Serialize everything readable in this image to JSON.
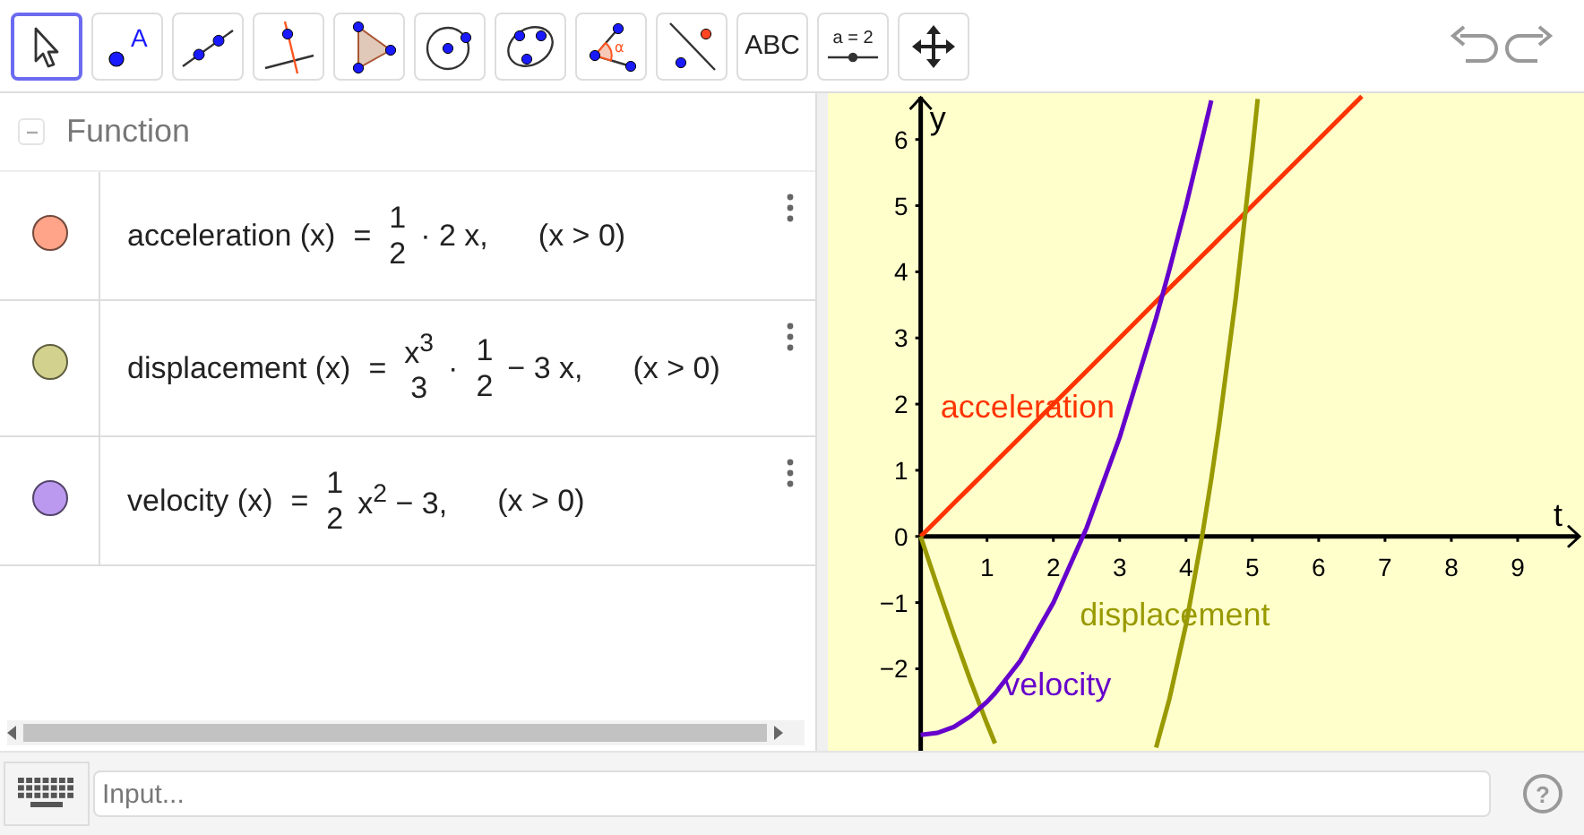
{
  "toolbar": {
    "tools": [
      {
        "kind": "move",
        "selected": true
      },
      {
        "kind": "point",
        "label": "A",
        "selected": false
      },
      {
        "kind": "line",
        "selected": false
      },
      {
        "kind": "perpendicular",
        "selected": false
      },
      {
        "kind": "polygon",
        "selected": false
      },
      {
        "kind": "circle",
        "selected": false
      },
      {
        "kind": "conic",
        "selected": false
      },
      {
        "kind": "angle",
        "label": "α",
        "selected": false
      },
      {
        "kind": "reflect",
        "selected": false
      },
      {
        "kind": "text",
        "label": "ABC",
        "selected": false
      },
      {
        "kind": "slider",
        "label": "a = 2",
        "selected": false
      },
      {
        "kind": "pan",
        "selected": false
      }
    ]
  },
  "algebra": {
    "group": {
      "title": "Function",
      "expanded": true
    },
    "functions": [
      {
        "name": "acceleration (x)",
        "color": "#ffa488",
        "parts": [
          {
            "kind": "text",
            "text": "="
          },
          {
            "kind": "frac",
            "num": "1",
            "den": "2"
          },
          {
            "kind": "text",
            "text": "· 2 x,"
          }
        ],
        "condition": "(x > 0)"
      },
      {
        "name": "displacement (x)",
        "color": "#d2d28e",
        "parts": [
          {
            "kind": "text",
            "text": "="
          },
          {
            "kind": "frac",
            "num": "x$^{3}$",
            "den": "3"
          },
          {
            "kind": "text",
            "text": "·"
          },
          {
            "kind": "frac",
            "num": "1",
            "den": "2"
          },
          {
            "kind": "text",
            "text": "− 3 x,"
          }
        ],
        "condition": "(x > 0)"
      },
      {
        "name": "velocity (x)",
        "color": "#bb99ee",
        "parts": [
          {
            "kind": "text",
            "text": "="
          },
          {
            "kind": "frac",
            "num": "1",
            "den": "2"
          },
          {
            "kind": "text",
            "text": "x$^{2}$ − 3,"
          }
        ],
        "condition": "(x > 0)"
      }
    ]
  },
  "graphics": {
    "chart_data": {
      "type": "line",
      "xlabel": "t",
      "ylabel": "y",
      "xlim": [
        -1.4,
        10
      ],
      "ylim": [
        -3.24,
        6.7
      ],
      "xticks": [
        1,
        2,
        3,
        4,
        5,
        6,
        7,
        8,
        9
      ],
      "yticks": [
        {
          "value": -2,
          "label": "−2"
        },
        {
          "value": -1,
          "label": "−1"
        },
        0,
        1,
        2,
        3,
        4,
        5,
        6
      ],
      "x": [
        0,
        0.25,
        0.5,
        0.75,
        1,
        1.12,
        1.5,
        2,
        2.5,
        3,
        3.55,
        3.75,
        4,
        4.25,
        4.38,
        4.5,
        4.75,
        5,
        5.08,
        6.65
      ],
      "series": [
        {
          "name": "acceleration",
          "color": "#ff3300",
          "values": [
            0,
            0.25,
            0.5,
            0.75,
            1,
            1.12,
            1.5,
            2,
            2.5,
            3,
            3.55,
            3.75,
            4,
            4.25,
            4.38,
            4.5,
            4.75,
            5,
            5.08,
            6.65
          ]
        },
        {
          "name": "displacement",
          "color": "#999900",
          "values": [
            0,
            -0.75,
            -1.48,
            -2.18,
            -2.83,
            -3.13,
            null,
            null,
            null,
            null,
            -3.19,
            -2.46,
            -1.33,
            0.04,
            0.87,
            1.69,
            3.61,
            5.83,
            6.61,
            null
          ]
        },
        {
          "name": "velocity",
          "color": "#6600cc",
          "values": [
            -3,
            -2.97,
            -2.88,
            -2.72,
            -2.5,
            -2.37,
            -1.88,
            -1,
            0.13,
            1.5,
            3.3,
            4.03,
            5,
            6.03,
            6.59,
            null,
            null,
            null,
            null,
            null
          ]
        }
      ]
    }
  },
  "input_bar": {
    "placeholder": "Input...",
    "help": "?"
  }
}
